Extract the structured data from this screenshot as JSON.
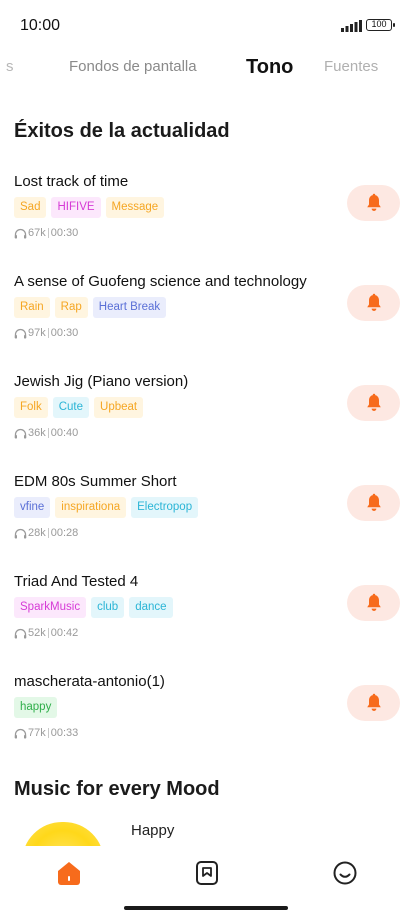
{
  "status_bar": {
    "time": "10:00",
    "battery": "100"
  },
  "tabs": [
    {
      "label": "s",
      "state": "partial"
    },
    {
      "label": "Fondos de pantalla",
      "state": "inactive"
    },
    {
      "label": "Tono",
      "state": "active"
    },
    {
      "label": "Fuentes",
      "state": "inactive"
    }
  ],
  "section_title": "Éxitos de la actualidad",
  "songs": [
    {
      "title": "Lost track of time",
      "tags": [
        {
          "label": "Sad",
          "color": "#f5a623",
          "bg": "#fff5e0"
        },
        {
          "label": "HIFIVE",
          "color": "#d63bd6",
          "bg": "#fce8fc"
        },
        {
          "label": "Message",
          "color": "#f5a623",
          "bg": "#fff5e0"
        }
      ],
      "plays": "67k",
      "duration": "00:30"
    },
    {
      "title": "A sense of Guofeng science and technology",
      "tags": [
        {
          "label": "Rain",
          "color": "#f5a623",
          "bg": "#fff5e0"
        },
        {
          "label": "Rap",
          "color": "#f5a623",
          "bg": "#fff5e0"
        },
        {
          "label": "Heart Break",
          "color": "#5a6fd6",
          "bg": "#eaedfc"
        }
      ],
      "plays": "97k",
      "duration": "00:30"
    },
    {
      "title": "Jewish Jig (Piano version)",
      "tags": [
        {
          "label": "Folk",
          "color": "#f5a623",
          "bg": "#fff5e0"
        },
        {
          "label": "Cute",
          "color": "#2bb5d6",
          "bg": "#e3f6fb"
        },
        {
          "label": "Upbeat",
          "color": "#f5a623",
          "bg": "#fff5e0"
        }
      ],
      "plays": "36k",
      "duration": "00:40"
    },
    {
      "title": "EDM 80s Summer Short",
      "tags": [
        {
          "label": "vfine",
          "color": "#5a6fd6",
          "bg": "#eaedfc"
        },
        {
          "label": "inspirationa",
          "color": "#f5a623",
          "bg": "#fff5e0"
        },
        {
          "label": "Electropop",
          "color": "#2bb5d6",
          "bg": "#e3f6fb"
        }
      ],
      "plays": "28k",
      "duration": "00:28"
    },
    {
      "title": "Triad And Tested 4",
      "tags": [
        {
          "label": "SparkMusic",
          "color": "#d63bd6",
          "bg": "#fce8fc"
        },
        {
          "label": "club",
          "color": "#2bb5d6",
          "bg": "#e3f6fb"
        },
        {
          "label": "dance",
          "color": "#2bb5d6",
          "bg": "#e3f6fb"
        }
      ],
      "plays": "52k",
      "duration": "00:42"
    },
    {
      "title": "mascherata-antonio(1)",
      "tags": [
        {
          "label": "happy",
          "color": "#2fae4a",
          "bg": "#e3f8e7"
        }
      ],
      "plays": "77k",
      "duration": "00:33"
    }
  ],
  "mood_section_title": "Music for every Mood",
  "mood_items": [
    {
      "label": "Happy"
    }
  ],
  "colors": {
    "accent": "#f76b1c",
    "bell_bg": "#fde8e2"
  },
  "icons": {
    "listen": "headphones-icon",
    "set_ringtone": "bell-icon",
    "nav": [
      "home-icon",
      "bookmark-icon",
      "smiley-icon"
    ]
  }
}
